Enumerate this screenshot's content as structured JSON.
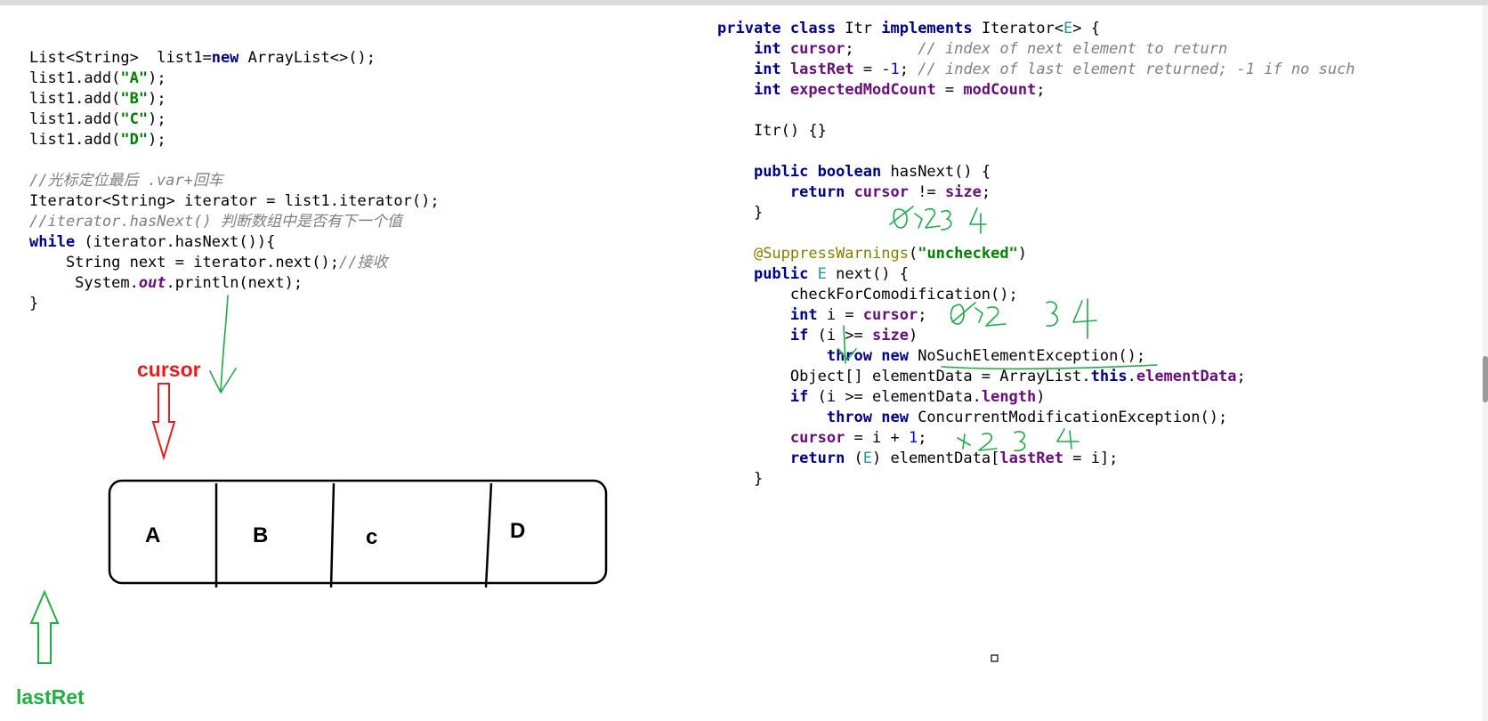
{
  "left_code": [
    "List<String>  list1=new ArrayList<>();",
    "list1.add(\"A\");",
    "list1.add(\"B\");",
    "list1.add(\"C\");",
    "list1.add(\"D\");",
    "",
    "//光标定位最后 .var+回车",
    "Iterator<String> iterator = list1.iterator();",
    "//iterator.hasNext() 判断数组中是否有下一个值",
    "while (iterator.hasNext()){",
    "    String next = iterator.next();//接收",
    "     System.out.println(next);",
    "}"
  ],
  "right_code": [
    "private class Itr implements Iterator<E> {",
    "    int cursor;       // index of next element to return",
    "    int lastRet = -1; // index of last element returned; -1 if no such",
    "    int expectedModCount = modCount;",
    "",
    "    Itr() {}",
    "",
    "    public boolean hasNext() {",
    "        return cursor != size;",
    "    }",
    "",
    "    @SuppressWarnings(\"unchecked\")",
    "    public E next() {",
    "        checkForComodification();",
    "        int i = cursor;",
    "        if (i >= size)",
    "            throw new NoSuchElementException();",
    "        Object[] elementData = ArrayList.this.elementData;",
    "        if (i >= elementData.length)",
    "            throw new ConcurrentModificationException();",
    "        cursor = i + 1;",
    "        return (E) elementData[lastRet = i];",
    "    }"
  ],
  "labels": {
    "cursor": "cursor",
    "lastRet": "lastRet"
  },
  "cells": [
    "A",
    "B",
    "c",
    "D"
  ],
  "colors": {
    "keyword": "#000080",
    "string": "#008000",
    "comment": "#808080",
    "field": "#660e7a",
    "annotation": "#808000",
    "cursor_arrow": "#e02020",
    "lastret_arrow": "#20b040",
    "handwriting": "#21a84a"
  }
}
